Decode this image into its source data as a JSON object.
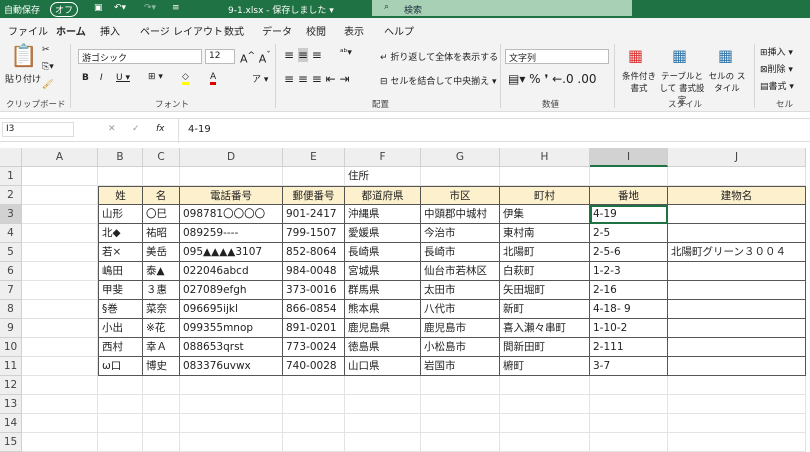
{
  "titlebar": {
    "autosave": "自動保存",
    "toggle": "オフ",
    "filename": "9-1.xlsx - 保存しました ▾",
    "search": "検索"
  },
  "tabs": [
    "ファイル",
    "ホーム",
    "挿入",
    "ページ レイアウト",
    "数式",
    "データ",
    "校閲",
    "表示",
    "ヘルプ"
  ],
  "ribbon": {
    "paste": "貼り付け",
    "font_name": "游ゴシック",
    "font_size": "12",
    "wrap": "折り返して全体を表示する",
    "merge": "セルを結合して中央揃え",
    "number_format": "文字列",
    "cond_format": "条件付き 書式",
    "table_format": "テーブルとして 書式設定",
    "cell_style": "セルの スタイル",
    "insert": "挿入",
    "delete": "削除",
    "format": "書式",
    "groups": [
      "クリップボード",
      "フォント",
      "配置",
      "数値",
      "スタイル",
      "セル"
    ]
  },
  "formula": {
    "name_box": "I3",
    "fx": "fx",
    "value": "4-19"
  },
  "columns": [
    "A",
    "B",
    "C",
    "D",
    "E",
    "F",
    "G",
    "H",
    "I",
    "J"
  ],
  "rows": [
    "1",
    "2",
    "3",
    "4",
    "5",
    "6",
    "7",
    "8",
    "9",
    "10",
    "11",
    "12",
    "13",
    "14",
    "15"
  ],
  "title_cell": "住所",
  "table_headers": [
    "姓",
    "名",
    "電話番号",
    "郵便番号",
    "都道府県",
    "市区",
    "町村",
    "番地",
    "建物名"
  ],
  "table_rows": [
    [
      "山形",
      "〇巳",
      "098781〇〇〇〇",
      "901-2417",
      "沖縄県",
      "中頭郡中城村",
      "伊集",
      "4-19",
      ""
    ],
    [
      "北◆",
      "祐昭",
      "089259----",
      "799-1507",
      "愛媛県",
      "今治市",
      "東村南",
      "2-5",
      ""
    ],
    [
      "若×",
      "美岳",
      "095▲▲▲▲3107",
      "852-8064",
      "長崎県",
      "長崎市",
      "北陽町",
      "2-5-6",
      "北陽町グリーン３００４"
    ],
    [
      "嶋田",
      "泰▲",
      "022046abcd",
      "984-0048",
      "宮城県",
      "仙台市若林区",
      "白萩町",
      "1-2-3",
      ""
    ],
    [
      "甲斐",
      "３惠",
      "027089efgh",
      "373-0016",
      "群馬県",
      "太田市",
      "矢田堀町",
      "2-16",
      ""
    ],
    [
      "§巻",
      "菜奈",
      "096695ijkl",
      "866-0854",
      "熊本県",
      "八代市",
      "新町",
      "4-18- 9",
      ""
    ],
    [
      "小出",
      "※花",
      "099355mnop",
      "891-0201",
      "鹿児島県",
      "鹿児島市",
      "喜入瀬々串町",
      "1-10-2",
      ""
    ],
    [
      "西村",
      "幸Ａ",
      "088653qrst",
      "773-0024",
      "徳島県",
      "小松島市",
      "間新田町",
      "2-111",
      ""
    ],
    [
      "ω口",
      "博史",
      "083376uvwx",
      "740-0028",
      "山口県",
      "岩国市",
      "椨町",
      "3-7",
      ""
    ]
  ]
}
